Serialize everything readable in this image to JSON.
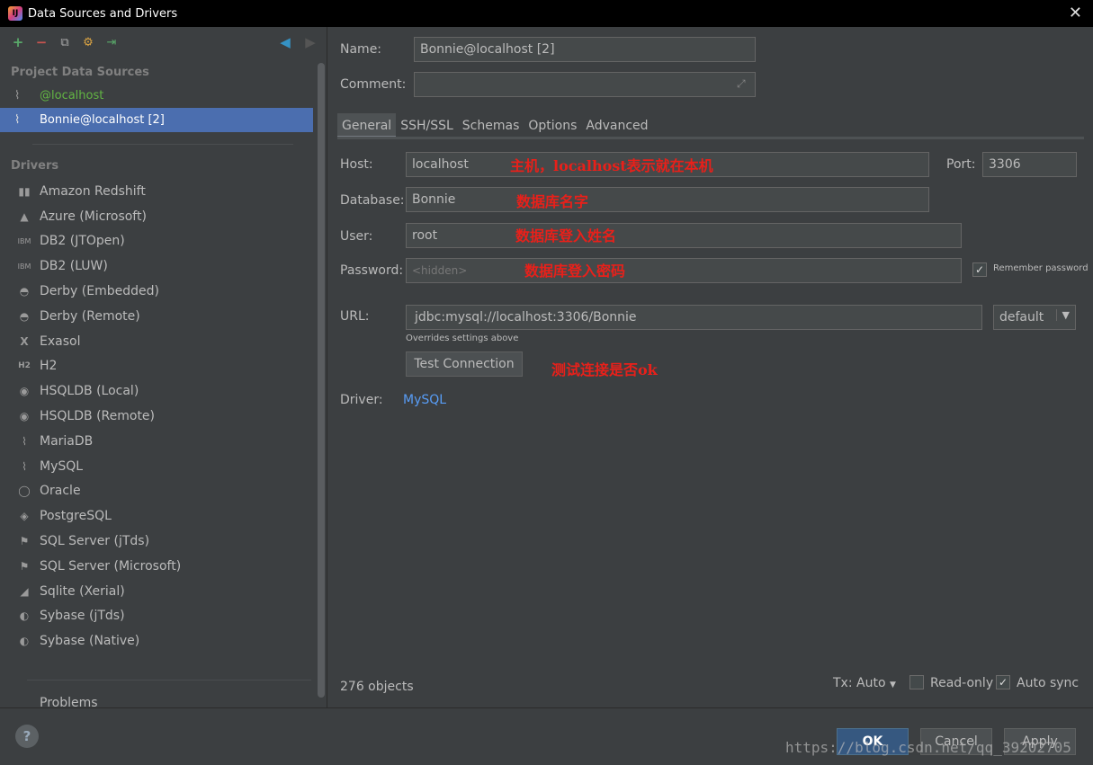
{
  "window": {
    "title": "Data Sources and Drivers",
    "app_icon_text": "IJ"
  },
  "sidebar": {
    "project_title": "Project Data Sources",
    "data_sources": [
      {
        "label": "@localhost",
        "icon": "mysql-dolphin-icon"
      },
      {
        "label": "Bonnie@localhost [2]",
        "icon": "mysql-dolphin-icon",
        "selected": true
      }
    ],
    "drivers_title": "Drivers",
    "drivers": [
      "Amazon Redshift",
      "Azure (Microsoft)",
      "DB2 (JTOpen)",
      "DB2 (LUW)",
      "Derby (Embedded)",
      "Derby (Remote)",
      "Exasol",
      "H2",
      "HSQLDB (Local)",
      "HSQLDB (Remote)",
      "MariaDB",
      "MySQL",
      "Oracle",
      "PostgreSQL",
      "SQL Server (jTds)",
      "SQL Server (Microsoft)",
      "Sqlite (Xerial)",
      "Sybase (jTds)",
      "Sybase (Native)"
    ],
    "problems": "Problems"
  },
  "form": {
    "name_label": "Name:",
    "name_value": "Bonnie@localhost [2]",
    "comment_label": "Comment:",
    "comment_value": "",
    "tabs": [
      "General",
      "SSH/SSL",
      "Schemas",
      "Options",
      "Advanced"
    ],
    "host_label": "Host:",
    "host_value": "localhost",
    "port_label": "Port:",
    "port_value": "3306",
    "database_label": "Database:",
    "database_value": "Bonnie",
    "user_label": "User:",
    "user_value": "root",
    "password_label": "Password:",
    "password_placeholder": "<hidden>",
    "remember_password": "Remember password",
    "url_label": "URL:",
    "url_value": "jdbc:mysql://localhost:3306/Bonnie",
    "url_mode": "default",
    "url_hint": "Overrides settings above",
    "test_connection": "Test Connection",
    "driver_label": "Driver:",
    "driver_value": "MySQL",
    "objects_count": "276 objects",
    "tx_mode": "Tx: Auto",
    "read_only": "Read-only",
    "auto_sync": "Auto sync"
  },
  "annotations": {
    "host": "主机，localhost表示就在本机",
    "database": "数据库名字",
    "user": "数据库登入姓名",
    "password": "数据库登入密码",
    "test": "测试连接是否ok"
  },
  "footer": {
    "help": "?",
    "ok": "OK",
    "cancel": "Cancel",
    "apply": "Apply",
    "watermark": "https://blog.csdn.net/qq_39202705"
  },
  "colors": {
    "background": "#3c3f41",
    "selection": "#4b6eaf",
    "annotation_red": "#e8201a",
    "link_blue": "#589df6",
    "source_green": "#62b543"
  }
}
